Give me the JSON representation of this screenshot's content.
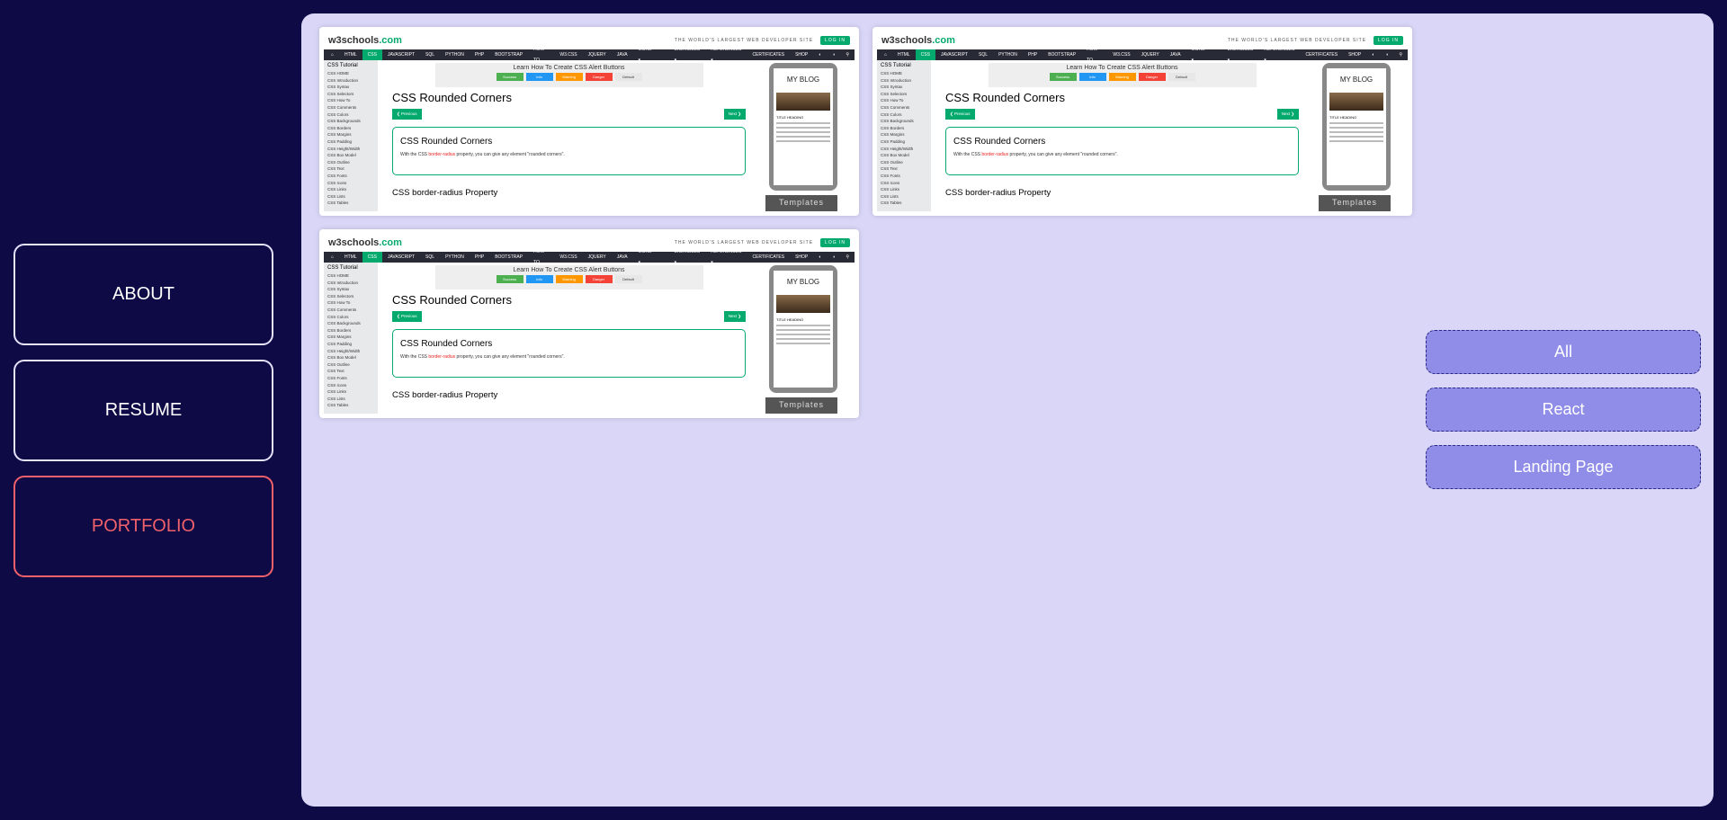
{
  "nav": {
    "items": [
      {
        "label": "ABOUT",
        "active": false
      },
      {
        "label": "RESUME",
        "active": false
      },
      {
        "label": "PORTFOLIO",
        "active": true
      }
    ]
  },
  "projects": [
    {
      "thumbnail": "w3schools-css-rounded-corners"
    },
    {
      "thumbnail": "w3schools-css-rounded-corners"
    },
    {
      "thumbnail": "w3schools-css-rounded-corners"
    }
  ],
  "thumb": {
    "logo_text": "w3schools",
    "logo_domain": ".com",
    "tagline": "THE WORLD'S LARGEST WEB DEVELOPER SITE",
    "login": "LOG IN",
    "nav": [
      "⌂",
      "HTML",
      "CSS",
      "JAVASCRIPT",
      "SQL",
      "PYTHON",
      "PHP",
      "BOOTSTRAP",
      "HOW TO",
      "W3.CSS",
      "JQUERY",
      "JAVA",
      "MORE ▾"
    ],
    "nav_right": [
      "EXERCISES ▾",
      "REFERENCES ▾",
      "CERTIFICATES",
      "SHOP",
      "◐",
      "◑",
      "⚲"
    ],
    "sidebar_title": "CSS Tutorial",
    "sidebar_items": [
      "CSS HOME",
      "CSS Introduction",
      "CSS Syntax",
      "CSS Selectors",
      "CSS How To",
      "CSS Comments",
      "CSS Colors",
      "CSS Backgrounds",
      "CSS Borders",
      "CSS Margins",
      "CSS Padding",
      "CSS Height/Width",
      "CSS Box Model",
      "CSS Outline",
      "CSS Text",
      "CSS Fonts",
      "CSS Icons",
      "CSS Links",
      "CSS Lists",
      "CSS Tables"
    ],
    "ad_title": "Learn How To Create CSS Alert Buttons",
    "ad_buttons": [
      {
        "label": "Success",
        "color": "#4caf50"
      },
      {
        "label": "Info",
        "color": "#2196f3"
      },
      {
        "label": "Warning",
        "color": "#ff9800"
      },
      {
        "label": "Danger",
        "color": "#f44336"
      },
      {
        "label": "Default",
        "color": "#e7e7e7"
      }
    ],
    "heading": "CSS Rounded Corners",
    "prev": "❮ Previous",
    "next": "Next ❯",
    "box_heading": "CSS Rounded Corners",
    "box_text_pre": "With the CSS ",
    "box_text_code": "border-radius",
    "box_text_post": " property, you can give any element \"rounded corners\".",
    "subheading": "CSS border-radius Property",
    "phone_title": "MY BLOG",
    "phone_heading": "TITLE HEADING",
    "templates": "Templates"
  },
  "filters": [
    {
      "label": "All"
    },
    {
      "label": "React"
    },
    {
      "label": "Landing Page"
    }
  ],
  "colors": {
    "background": "#0d0a45",
    "panel": "#d9d6f7",
    "active_accent": "#f0606a",
    "filter_bg": "#8f8de8"
  }
}
